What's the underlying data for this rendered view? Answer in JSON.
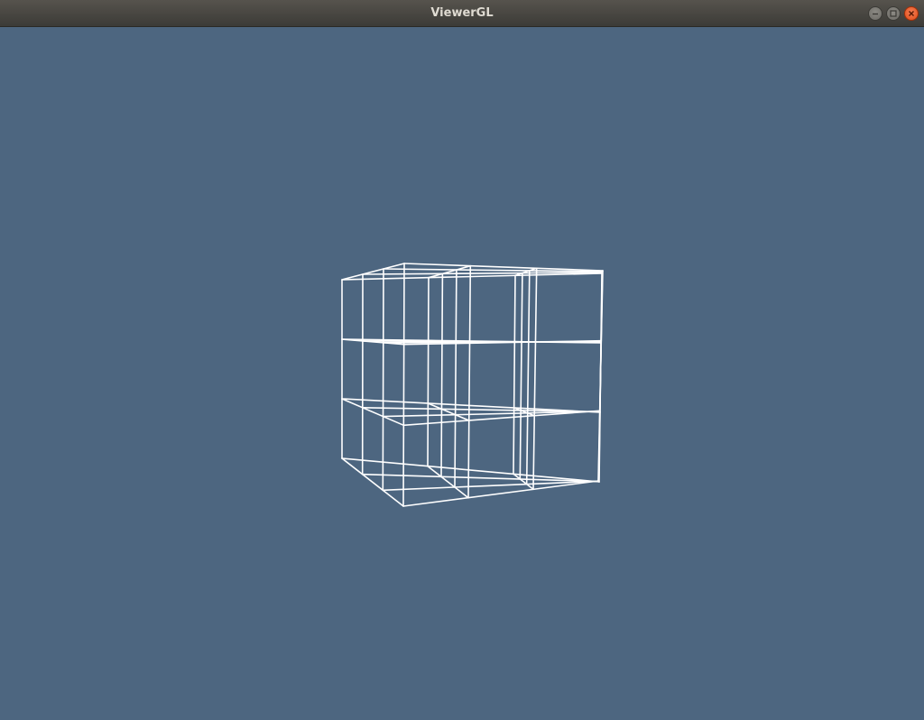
{
  "window": {
    "title": "ViewerGL"
  },
  "controls": {
    "minimize_icon": "minimize-icon",
    "maximize_icon": "maximize-icon",
    "close_icon": "close-icon"
  },
  "viewport": {
    "background_color": "#4d6680",
    "wire_color": "#ffffff",
    "object": "wireframe-cube-3x3x3"
  }
}
